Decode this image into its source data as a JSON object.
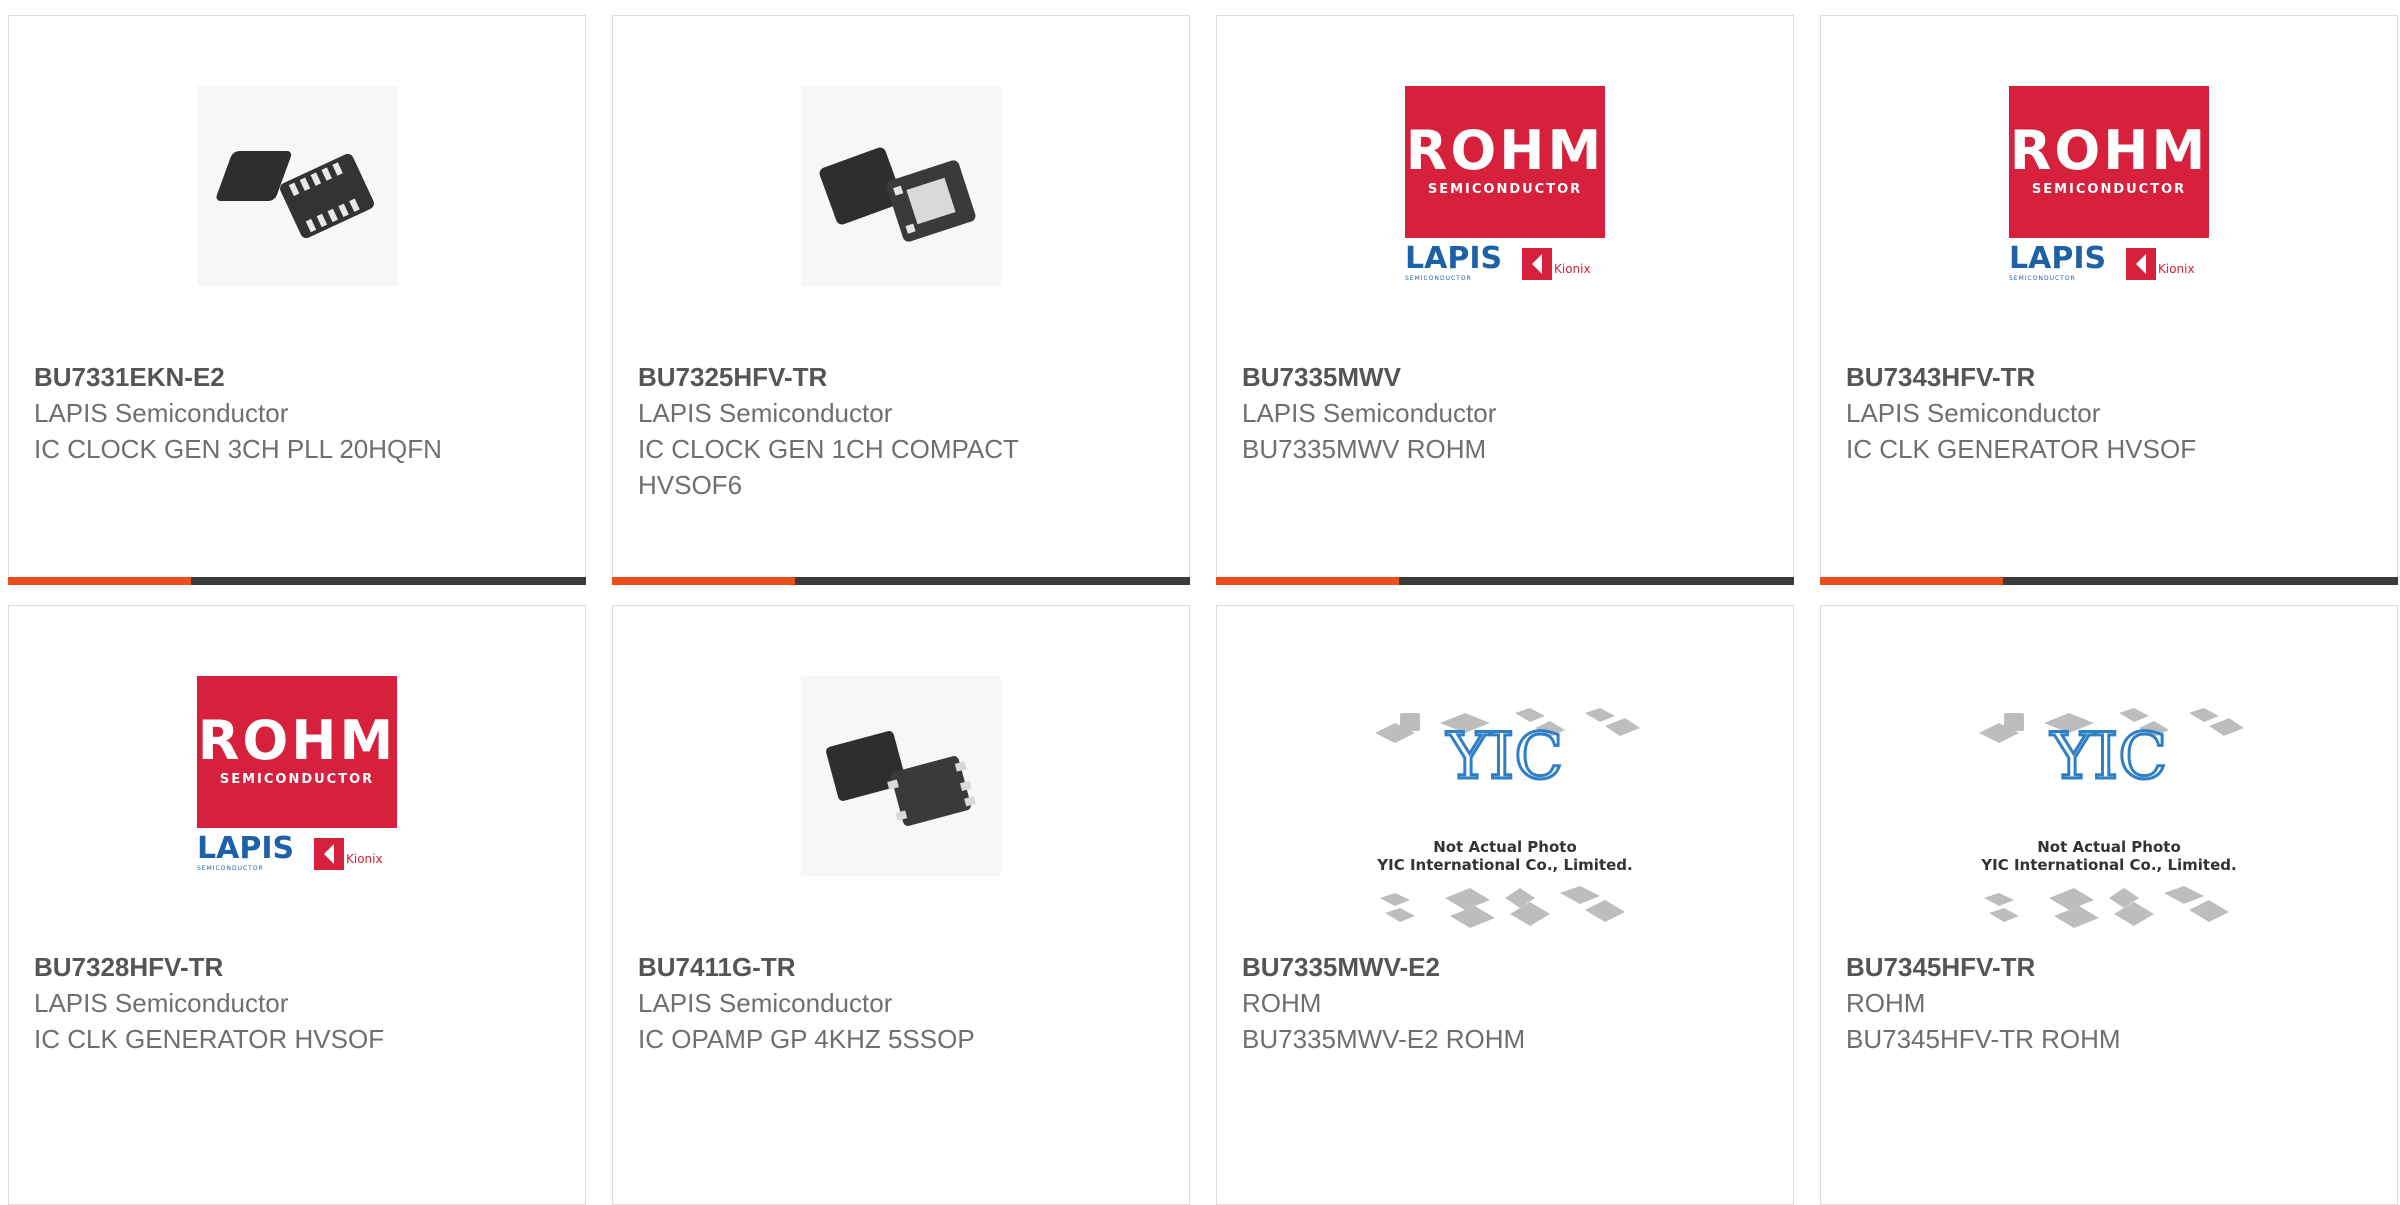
{
  "products": [
    {
      "part": "BU7331EKN-E2",
      "manufacturer": "LAPIS Semiconductor",
      "description": "IC CLOCK GEN 3CH PLL 20HQFN",
      "image": "qfn-chip-photo"
    },
    {
      "part": "BU7325HFV-TR",
      "manufacturer": "LAPIS Semiconductor",
      "description": "IC CLOCK GEN 1CH COMPACT HVSOF6",
      "image": "hvsof-chip-photo"
    },
    {
      "part": "BU7335MWV",
      "manufacturer": "LAPIS Semiconductor",
      "description": "BU7335MWV ROHM",
      "image": "rohm-logo"
    },
    {
      "part": "BU7343HFV-TR",
      "manufacturer": "LAPIS Semiconductor",
      "description": "IC CLK GENERATOR HVSOF",
      "image": "rohm-logo"
    },
    {
      "part": "BU7328HFV-TR",
      "manufacturer": "LAPIS Semiconductor",
      "description": "IC CLK GENERATOR HVSOF",
      "image": "rohm-logo"
    },
    {
      "part": "BU7411G-TR",
      "manufacturer": "LAPIS Semiconductor",
      "description": "IC OPAMP GP 4KHZ 5SSOP",
      "image": "ssop-chip-photo"
    },
    {
      "part": "BU7335MWV-E2",
      "manufacturer": "ROHM",
      "description": "BU7335MWV-E2 ROHM",
      "image": "yic-placeholder"
    },
    {
      "part": "BU7345HFV-TR",
      "manufacturer": "ROHM",
      "description": "BU7345HFV-TR ROHM",
      "image": "yic-placeholder"
    }
  ],
  "logos": {
    "rohm_word": "ROHM",
    "rohm_sub": "SEMICONDUCTOR",
    "lapis_word": "LAPIS",
    "lapis_sub": "SEMICONDUCTOR",
    "kionix_word": "Kionix"
  },
  "yic": {
    "line1": "Not Actual Photo",
    "line2": "YIC International Co., Limited."
  },
  "colors": {
    "accent": "#e94e1b",
    "bar": "#3b3b3b",
    "rohm_red": "#d7203b",
    "lapis_blue": "#1d61a8"
  }
}
